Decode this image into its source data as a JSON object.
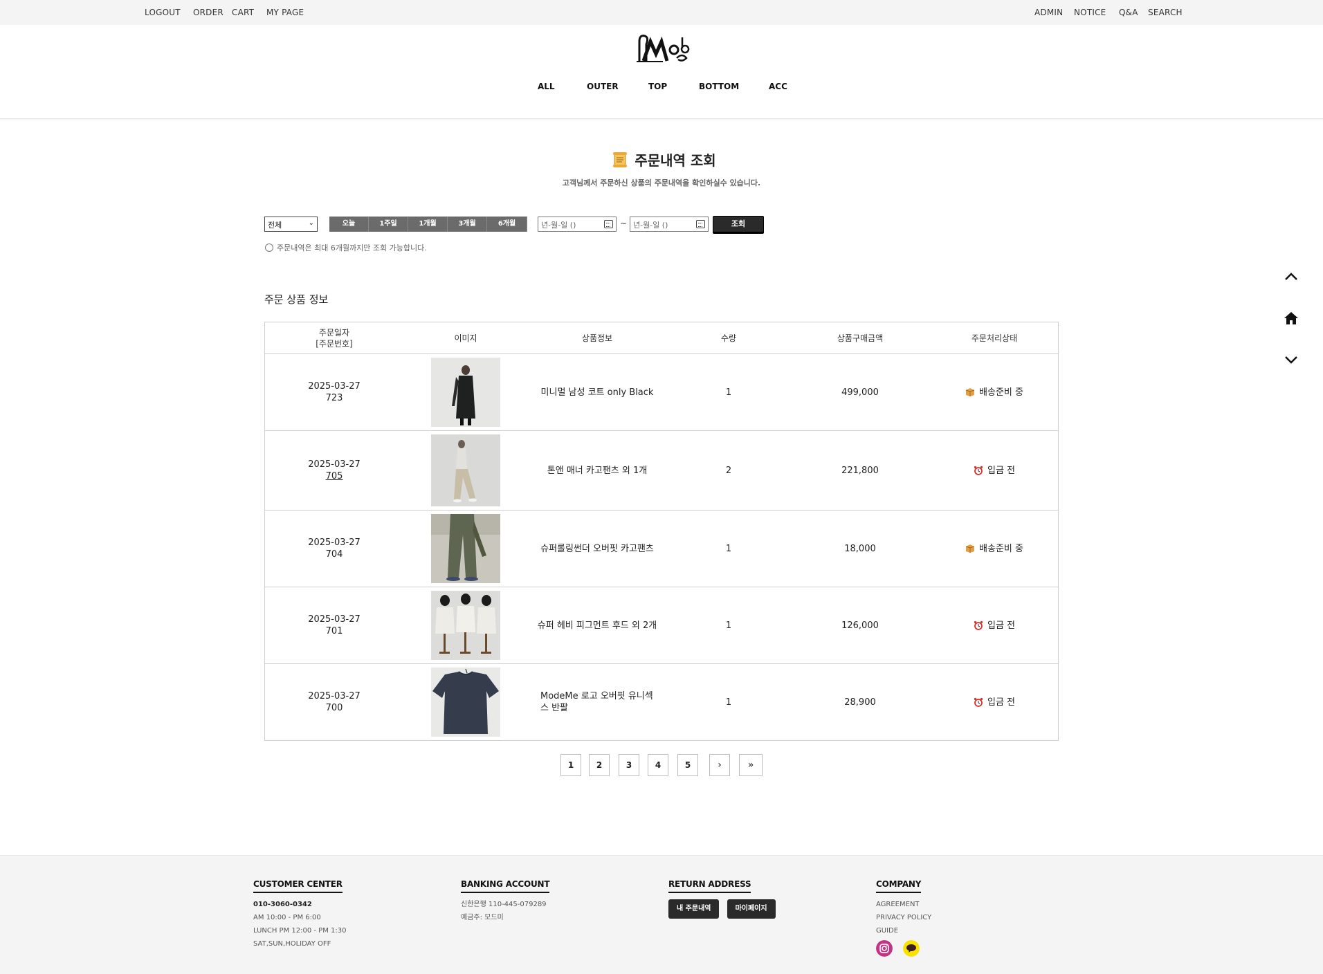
{
  "topbar": {
    "left": [
      "LOGOUT",
      "ORDER",
      "CART",
      "MY PAGE"
    ],
    "right": [
      "ADMIN",
      "NOTICE",
      "Q&A",
      "SEARCH"
    ]
  },
  "header": {
    "logo_text": "Mode",
    "gnb": [
      "ALL",
      "OUTER",
      "TOP",
      "BOTTOM",
      "ACC"
    ]
  },
  "page": {
    "title": "주문내역 조회",
    "subtitle": "고객님께서 주문하신 상품의 주문내역을 확인하실수 있습니다."
  },
  "filter": {
    "status_select": "전체",
    "periods": [
      "오늘",
      "1주일",
      "1개월",
      "3개월",
      "6개월"
    ],
    "date_from_placeholder": "년-월-일 ()",
    "date_to_placeholder": "년-월-일 ()",
    "tilde": "~",
    "search_label": "조회",
    "notice": "주문내역은 최대 6개월까지만 조회 가능합니다."
  },
  "orders": {
    "section_title": "주문 상품 정보",
    "headers": [
      "주문일자\n[주문번호]",
      "이미지",
      "상품정보",
      "수량",
      "상품구매금액",
      "주문처리상태"
    ],
    "rows": [
      {
        "date": "2025-03-27",
        "no": "723",
        "product": "미니멀 남성 코트 only Black",
        "qty": "1",
        "price": "499,000",
        "status": "배송준비 중",
        "status_icon": "box-icon"
      },
      {
        "date": "2025-03-27",
        "no": "705",
        "product": "톤앤 매너 카고팬츠 외 1개",
        "qty": "2",
        "price": "221,800",
        "status": "입금 전",
        "status_icon": "alarm-clock-icon"
      },
      {
        "date": "2025-03-27",
        "no": "704",
        "product": "슈퍼롤링썬더 오버핏 카고팬츠",
        "qty": "1",
        "price": "18,000",
        "status": "배송준비 중",
        "status_icon": "box-icon"
      },
      {
        "date": "2025-03-27",
        "no": "701",
        "product": "슈퍼 헤비 피그먼트 후드 외 2개",
        "qty": "1",
        "price": "126,000",
        "status": "입금 전",
        "status_icon": "alarm-clock-icon"
      },
      {
        "date": "2025-03-27",
        "no": "700",
        "product": "ModeMe 로고 오버핏 유니섹스 반팔",
        "qty": "1",
        "price": "28,900",
        "status": "입금 전",
        "status_icon": "alarm-clock-icon"
      }
    ]
  },
  "pagination": {
    "pages": [
      "1",
      "2",
      "3",
      "4",
      "5"
    ],
    "next": "›",
    "last": "»"
  },
  "footer": {
    "customer_center": {
      "title": "CUSTOMER CENTER",
      "phone": "010-3060-0342",
      "lines": [
        "AM 10:00 - PM 6:00",
        "LUNCH PM 12:00 - PM 1:30",
        "SAT,SUN,HOLIDAY OFF"
      ]
    },
    "banking": {
      "title": "BANKING ACCOUNT",
      "lines": [
        "신한은행 110-445-079289",
        "예금주: 모드미"
      ]
    },
    "return": {
      "title": "RETURN ADDRESS",
      "buttons": [
        "내 주문내역",
        "마이페이지"
      ]
    },
    "company": {
      "title": "COMPANY",
      "links": [
        "AGREEMENT",
        "PRIVACY POLICY",
        "GUIDE"
      ]
    }
  },
  "colors": {
    "instagram": "#c13584",
    "kakao": "#fae100",
    "period_button": "#6b6b6b",
    "dark_button": "#2a2a2a"
  }
}
